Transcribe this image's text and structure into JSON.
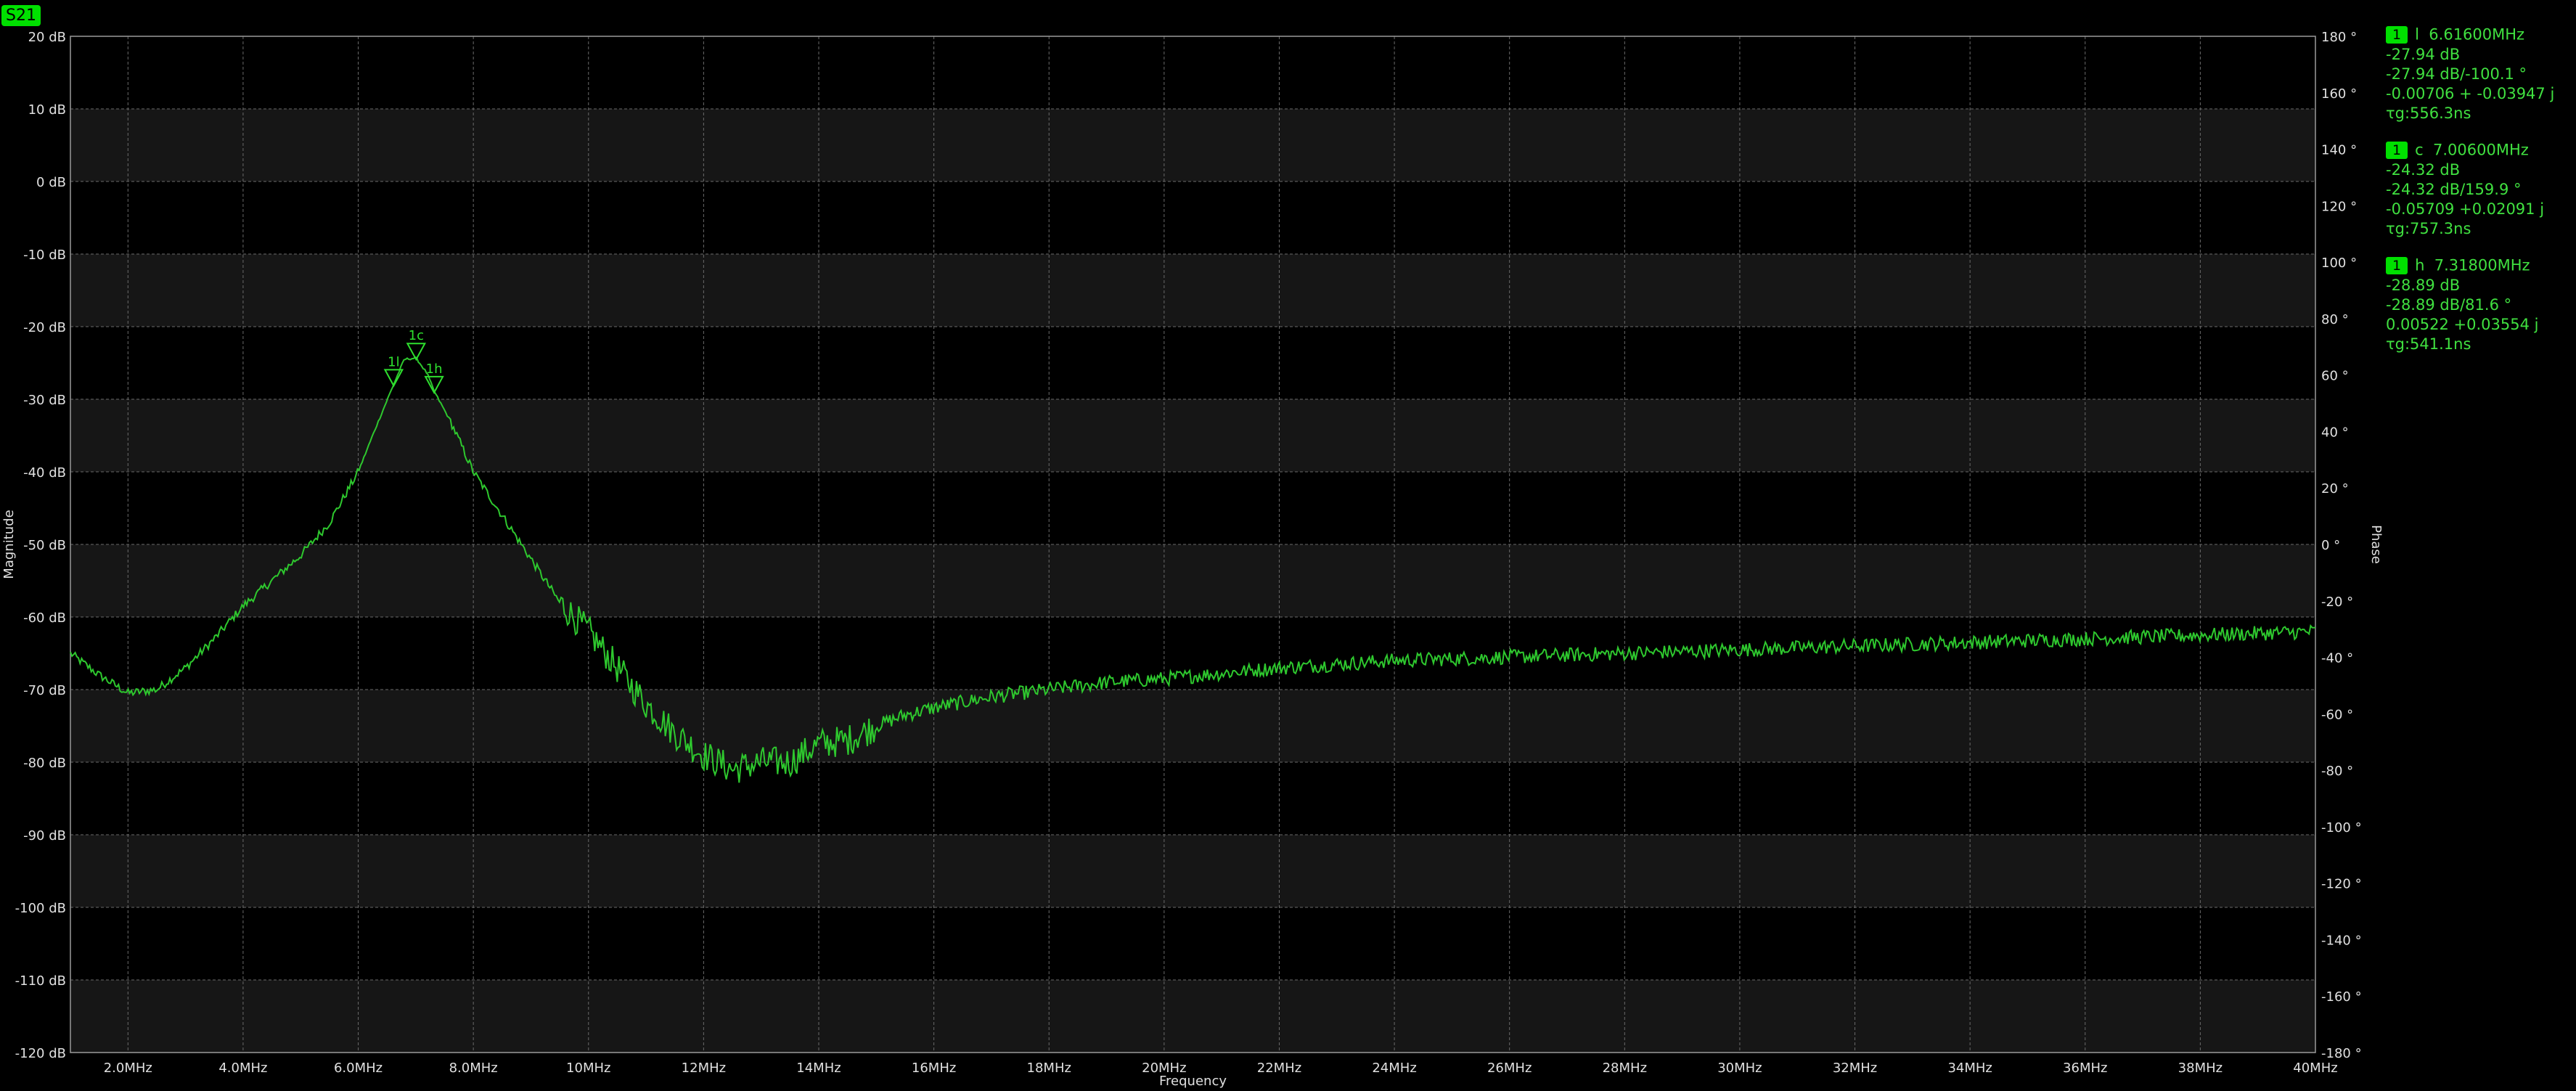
{
  "trace_label": "S21",
  "chart_data": {
    "type": "line",
    "xlabel": "Frequency",
    "ylabel": "Magnitude",
    "y2label": "Phase",
    "xlim": [
      1.0,
      40.0
    ],
    "ylim": [
      -120,
      20
    ],
    "y2lim": [
      -180,
      180
    ],
    "x_ticks": [
      2,
      4,
      6,
      8,
      10,
      12,
      14,
      16,
      18,
      20,
      22,
      24,
      26,
      28,
      30,
      32,
      34,
      36,
      38,
      40
    ],
    "x_tick_labels": [
      "2.0MHz",
      "4.0MHz",
      "6.0MHz",
      "8.0MHz",
      "10MHz",
      "12MHz",
      "14MHz",
      "16MHz",
      "18MHz",
      "20MHz",
      "22MHz",
      "24MHz",
      "26MHz",
      "28MHz",
      "30MHz",
      "32MHz",
      "34MHz",
      "36MHz",
      "38MHz",
      "40MHz"
    ],
    "y_ticks": [
      20,
      10,
      0,
      -10,
      -20,
      -30,
      -40,
      -50,
      -60,
      -70,
      -80,
      -90,
      -100,
      -110,
      -120
    ],
    "y_tick_labels": [
      "20 dB",
      "10 dB",
      "0 dB",
      "-10 dB",
      "-20 dB",
      "-30 dB",
      "-40 dB",
      "-50 dB",
      "-60 dB",
      "-70 dB",
      "-80 dB",
      "-90 dB",
      "-100 dB",
      "-110 dB",
      "-120 dB"
    ],
    "y2_ticks": [
      180,
      160,
      140,
      120,
      100,
      80,
      60,
      40,
      20,
      0,
      -20,
      -40,
      -60,
      -80,
      -100,
      -120,
      -140,
      -160,
      -180
    ],
    "y2_tick_labels": [
      "180 °",
      "160 °",
      "140 °",
      "120 °",
      "100 °",
      "80 °",
      "60 °",
      "40 °",
      "20 °",
      "0 °",
      "-20 °",
      "-40 °",
      "-60 °",
      "-80 °",
      "-100 °",
      "-120 °",
      "-140 °",
      "-160 °",
      "-180 °"
    ],
    "grid": true,
    "series": [
      {
        "color": "#2ec82e",
        "x": [
          1.0,
          1.5,
          2.0,
          2.5,
          3.0,
          3.5,
          4.0,
          4.5,
          5.0,
          5.5,
          6.0,
          6.3,
          6.616,
          6.8,
          7.006,
          7.2,
          7.318,
          7.6,
          8.0,
          8.5,
          9.0,
          9.5,
          10.0,
          10.5,
          11.0,
          11.5,
          12.0,
          12.5,
          13.0,
          13.5,
          14.0,
          14.5,
          15.0,
          15.5,
          16.0,
          17.0,
          18.0,
          19.0,
          20.0,
          22.0,
          24.0,
          26.0,
          28.0,
          30.0,
          32.0,
          34.0,
          36.0,
          38.0,
          40.0
        ],
        "values": [
          -65,
          -68,
          -70.5,
          -70,
          -67,
          -63,
          -58.5,
          -55,
          -51.5,
          -47,
          -40,
          -34,
          -27.94,
          -24.5,
          -24.32,
          -26.5,
          -28.89,
          -33,
          -40,
          -46,
          -52,
          -58,
          -62,
          -67,
          -72,
          -76,
          -79,
          -81,
          -80,
          -80,
          -77.5,
          -77,
          -75,
          -73.5,
          -72.5,
          -71,
          -70,
          -69,
          -68.5,
          -67,
          -66,
          -65.5,
          -65,
          -64.5,
          -64,
          -63.5,
          -63,
          -62.5,
          -62
        ]
      }
    ],
    "markers": [
      {
        "label": "1l",
        "x": 6.616,
        "y": -27.94
      },
      {
        "label": "1c",
        "x": 7.006,
        "y": -24.32
      },
      {
        "label": "1h",
        "x": 7.318,
        "y": -28.89
      }
    ]
  },
  "marker_panel": [
    {
      "badge": "1",
      "name": "l",
      "freq": "6.61600MHz",
      "mag": "-27.94 dB",
      "magphase": "-27.94 dB/-100.1 °",
      "complex": "-0.00706 + -0.03947 j",
      "tg": "τg:556.3ns"
    },
    {
      "badge": "1",
      "name": "c",
      "freq": "7.00600MHz",
      "mag": "-24.32 dB",
      "magphase": "-24.32 dB/159.9 °",
      "complex": "-0.05709 +0.02091 j",
      "tg": "τg:757.3ns"
    },
    {
      "badge": "1",
      "name": "h",
      "freq": "7.31800MHz",
      "mag": "-28.89 dB",
      "magphase": "-28.89 dB/81.6 °",
      "complex": "0.00522 +0.03554 j",
      "tg": "τg:541.1ns"
    }
  ]
}
